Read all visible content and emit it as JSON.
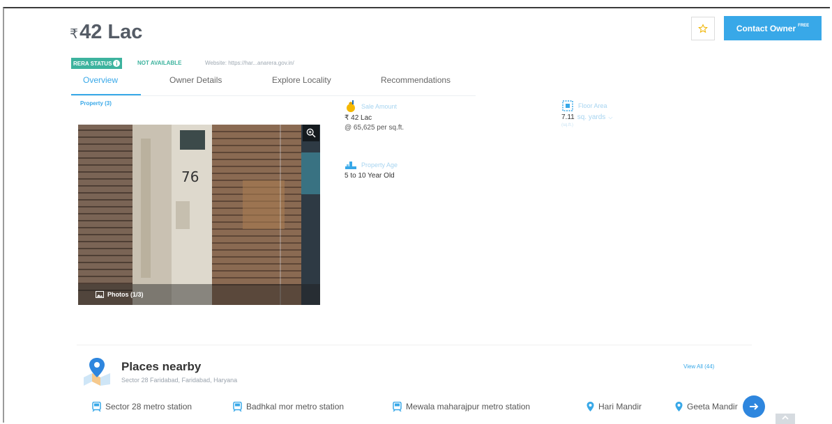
{
  "header": {
    "currency_symbol": "₹",
    "price": "42 Lac",
    "contact_label": "Contact Owner",
    "contact_badge": "FREE",
    "star_icon": "star-outline-icon",
    "accent_color": "#38a8e8"
  },
  "rera": {
    "status_label": "RERA STATUS",
    "status_value": "NOT AVAILABLE",
    "website": "Website: https://har...anarera.gov.in/",
    "badge_color": "#3db39e"
  },
  "tabs": [
    {
      "label": "Overview",
      "active": true
    },
    {
      "label": "Owner Details",
      "active": false
    },
    {
      "label": "Explore Locality",
      "active": false
    },
    {
      "label": "Recommendations",
      "active": false
    }
  ],
  "property_label": "Property (3)",
  "photo": {
    "count_label": "Photos (1/3)",
    "number_text": "76"
  },
  "details": {
    "sale_amount_label": "Sale Amount",
    "sale_amount_value": "₹ 42 Lac",
    "sale_amount_rate": "@ 65,625 per sq.ft.",
    "area_label": "Floor Area",
    "area_value": "7.11",
    "area_unit": "sq. yards",
    "area_sub": "(sq.ft.)",
    "age_label": "Property Age",
    "age_value": "5 to 10 Year Old"
  },
  "places": {
    "title": "Places nearby",
    "subtitle": "Sector 28 Faridabad, Faridabad, Haryana",
    "view_all": "View All (44)",
    "items": [
      {
        "label": "Sector 28 metro station",
        "icon": "metro-icon"
      },
      {
        "label": "Badhkal mor metro station",
        "icon": "metro-icon"
      },
      {
        "label": "Mewala maharajpur metro station",
        "icon": "metro-icon"
      },
      {
        "label": "Hari Mandir",
        "icon": "pin-icon"
      },
      {
        "label": "Geeta Mandir",
        "icon": "pin-icon"
      }
    ]
  }
}
